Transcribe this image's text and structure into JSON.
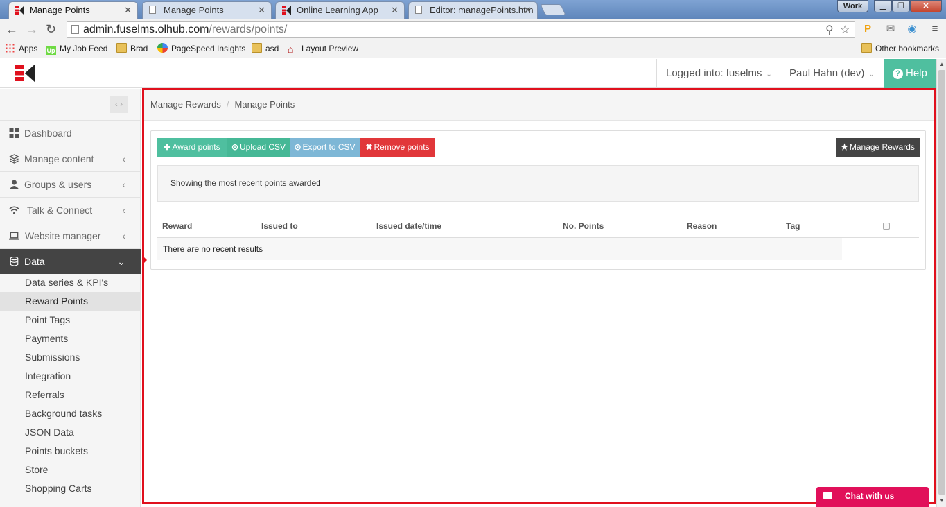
{
  "browser": {
    "tabs": [
      {
        "title": "Manage Points",
        "active": true
      },
      {
        "title": "Manage Points",
        "active": false
      },
      {
        "title": "Online Learning App",
        "active": false
      },
      {
        "title": "Editor: managePoints.htm",
        "active": false
      }
    ],
    "window_profile": "Work",
    "url_host": "admin.fuselms.olhub.com",
    "url_path": "/rewards/points/",
    "bookmarks": [
      "Apps",
      "My Job Feed",
      "Brad",
      "PageSpeed Insights",
      "asd",
      "Layout Preview"
    ],
    "other_bookmarks": "Other bookmarks"
  },
  "header": {
    "logged_into": "Logged into: fuselms",
    "user": "Paul Hahn (dev)",
    "help": "Help"
  },
  "sidebar": {
    "items": [
      {
        "label": "Dashboard"
      },
      {
        "label": "Manage content"
      },
      {
        "label": "Groups & users"
      },
      {
        "label": "Talk & Connect"
      },
      {
        "label": "Website manager"
      },
      {
        "label": "Data"
      }
    ],
    "subitems": [
      {
        "label": "Data series & KPI's"
      },
      {
        "label": "Reward Points"
      },
      {
        "label": "Point Tags"
      },
      {
        "label": "Payments"
      },
      {
        "label": "Submissions"
      },
      {
        "label": "Integration"
      },
      {
        "label": "Referrals"
      },
      {
        "label": "Background tasks"
      },
      {
        "label": "JSON Data"
      },
      {
        "label": "Points buckets"
      },
      {
        "label": "Store"
      },
      {
        "label": "Shopping Carts"
      }
    ]
  },
  "breadcrumb": {
    "parent": "Manage Rewards",
    "separator": "/",
    "current": "Manage Points"
  },
  "toolbar": {
    "award": "Award points",
    "upload": "Upload CSV",
    "export": "Export to CSV",
    "remove": "Remove points",
    "manage_rewards": "Manage Rewards"
  },
  "notice": "Showing the most recent points awarded",
  "table": {
    "columns": [
      "Reward",
      "Issued to",
      "Issued date/time",
      "No. Points",
      "Reason",
      "Tag"
    ],
    "empty": "There are no recent results"
  },
  "chat": "Chat with us",
  "colors": {
    "accent_green": "#4fbf9f",
    "export_blue": "#7eb7d6",
    "remove_red": "#e1373a",
    "highlight_red": "#e0101d",
    "chat_pink": "#e1105a"
  }
}
